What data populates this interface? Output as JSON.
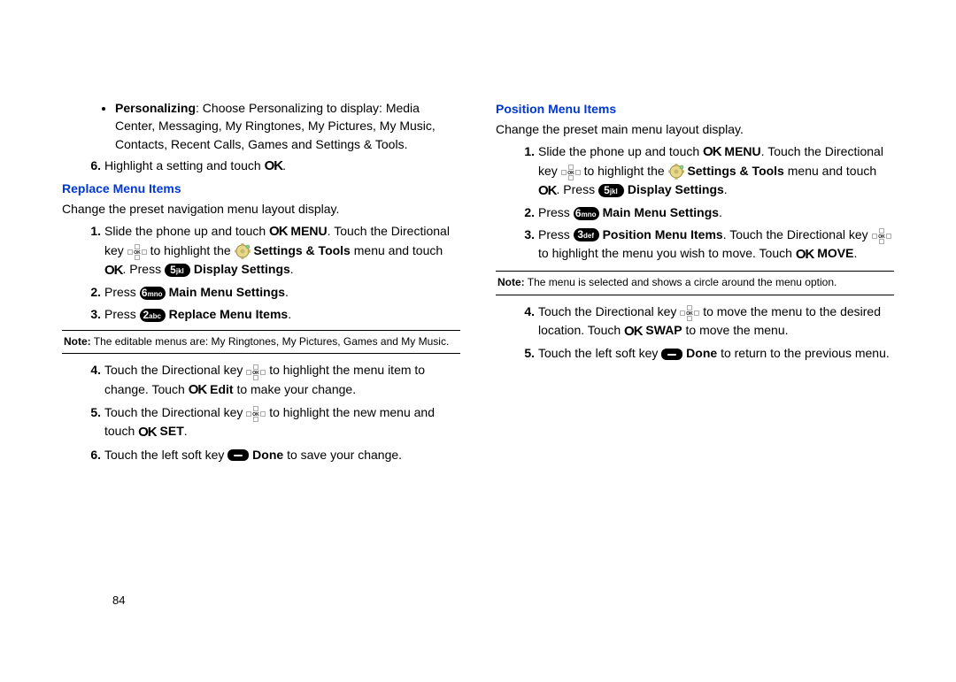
{
  "pageNumber": "84",
  "left": {
    "bullet": {
      "label": "Personalizing",
      "text": ": Choose Personalizing to display: Media Center, Messaging, My Ringtones, My Pictures, My  Music, Contacts, Recent Calls, Games and Settings & Tools."
    },
    "step6_pre": "Highlight a setting and touch ",
    "heading": "Replace Menu Items",
    "intro": "Change the preset navigation menu layout display.",
    "s1_a": "Slide the phone up and touch ",
    "s1_b": " MENU",
    "s1_c": ". Touch the Directional key ",
    "s1_d": " to highlight the ",
    "s1_e": "Settings & Tools",
    "s1_f": " menu and touch ",
    "s1_g": ". Press ",
    "s1_h": "Display Settings",
    "s2_a": "Press ",
    "s2_b": " Main Menu Settings",
    "s3_a": "Press ",
    "s3_b": " Replace Menu Items",
    "note_label": "Note:",
    "note_text": " The editable menus are: My Ringtones, My Pictures, Games and My Music.",
    "s4_a": "Touch the Directional key ",
    "s4_b": " to highlight the menu item to change. Touch ",
    "s4_c": " Edit",
    "s4_d": " to make your change.",
    "s5_a": "Touch the Directional key ",
    "s5_b": " to highlight the new menu and touch ",
    "s5_c": " SET",
    "s6_a": "Touch the left soft key ",
    "s6_b": " Done",
    "s6_c": " to save your change."
  },
  "right": {
    "heading": "Position Menu Items",
    "intro": "Change the preset main menu layout display.",
    "s1_a": "Slide the phone up and touch ",
    "s1_b": " MENU",
    "s1_c": ". Touch the Directional key ",
    "s1_d": " to highlight the ",
    "s1_e": "Settings & Tools",
    "s1_f": " menu and touch ",
    "s1_g": ". Press ",
    "s1_h": "Display Settings",
    "s2_a": "Press ",
    "s2_b": " Main Menu Settings",
    "s3_a": "Press ",
    "s3_b": " Position Menu Items",
    "s3_c": ". Touch the Directional key ",
    "s3_d": " to highlight the menu you wish to move. Touch ",
    "s3_e": " MOVE",
    "note_label": "Note:",
    "note_text": " The menu is selected and shows a circle around the menu option.",
    "s4_a": "Touch the Directional key ",
    "s4_b": " to move the menu to the desired location. Touch ",
    "s4_c": " SWAP",
    "s4_d": " to move the menu.",
    "s5_a": "Touch the left soft key ",
    "s5_b": " Done",
    "s5_c": " to return to the previous menu."
  },
  "keys": {
    "k2": {
      "num": "2",
      "lbl": "abc"
    },
    "k3": {
      "num": "3",
      "lbl": "def"
    },
    "k5": {
      "num": "5",
      "lbl": "jkl"
    },
    "k6": {
      "num": "6",
      "lbl": "mno"
    }
  }
}
